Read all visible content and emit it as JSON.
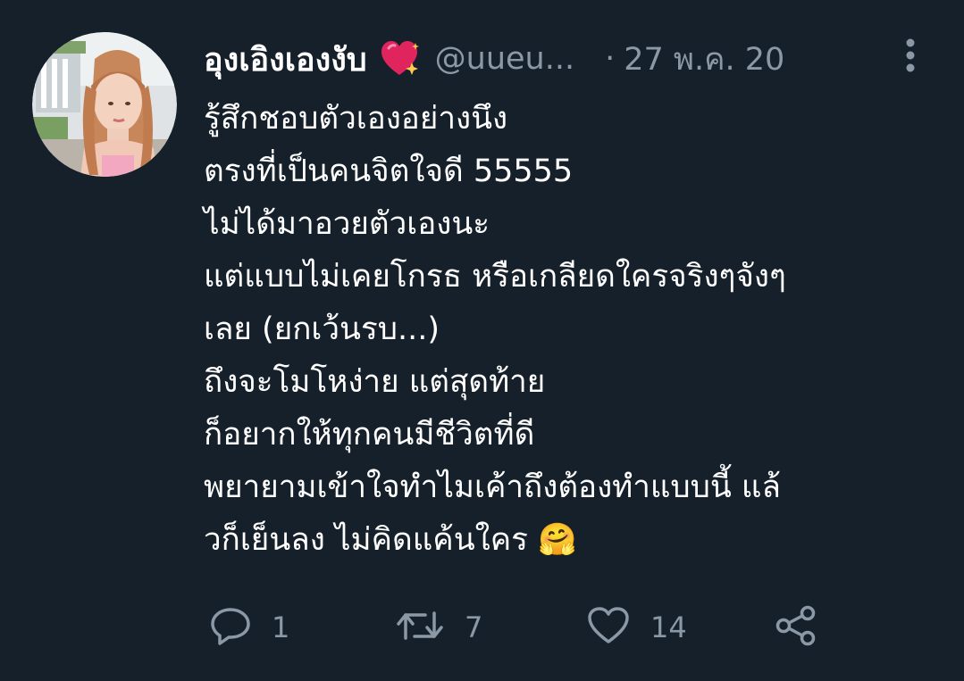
{
  "tweet": {
    "author": {
      "display_name": "อุงเอิงเองงับ",
      "handle": "@uueu...",
      "badge_icon": "sparkling-heart-icon"
    },
    "separator": "·",
    "date": "27 พ.ค. 20",
    "text": "รู้สึกชอบตัวเองอย่างนึง\nตรงที่เป็นคนจิตใจดี 55555\nไม่ได้มาอวยตัวเองนะ\nแต่แบบไม่เคยโกรธ หรือเกลียดใครจริงๆจังๆ\nเลย (ยกเว้นรบ...)\nถึงจะโมโหง่าย แต่สุดท้าย\nก็อยากให้ทุกคนมีชีวิตที่ดี\nพยายามเข้าใจทำไมเค้าถึงต้องทำแบบนี้ แล้\nวก็เย็นลง ไม่คิดแค้นใคร 🤗",
    "actions": {
      "reply_count": "1",
      "retweet_count": "7",
      "like_count": "14"
    }
  },
  "colors": {
    "background": "#15202b",
    "text_primary": "#ffffff",
    "text_secondary": "#8b98a5",
    "heart": "#e0245e"
  }
}
